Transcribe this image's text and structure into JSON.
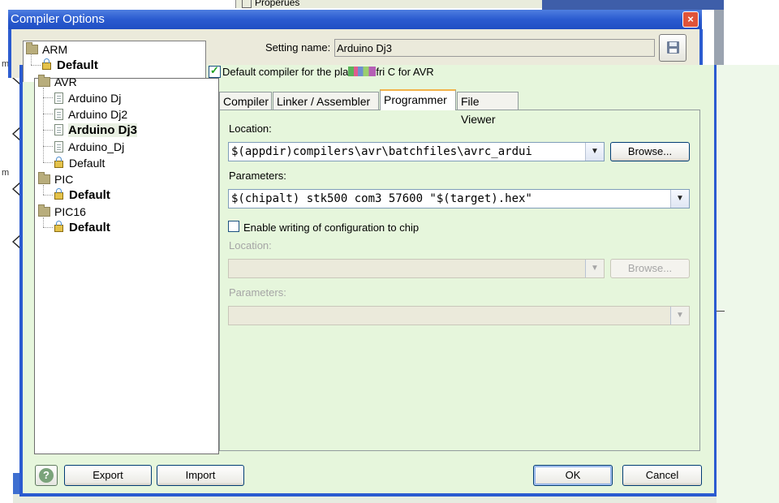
{
  "background": {
    "properties_label": "Properues",
    "left_labels": [
      "m",
      "m"
    ]
  },
  "dialog": {
    "title": "Compiler Options",
    "close_glyph": "×"
  },
  "tree": {
    "groups": [
      {
        "label": "ARM",
        "children": [
          {
            "label": "Default",
            "kind": "lock",
            "bold": true
          }
        ]
      },
      {
        "label": "AVR",
        "children": [
          {
            "label": "Arduino Dj",
            "kind": "doc"
          },
          {
            "label": "Arduino Dj2",
            "kind": "doc"
          },
          {
            "label": "Arduino Dj3",
            "kind": "doc",
            "bold": true,
            "selected": true
          },
          {
            "label": "Arduino_Dj",
            "kind": "doc"
          },
          {
            "label": "Default",
            "kind": "lock"
          }
        ]
      },
      {
        "label": "PIC",
        "children": [
          {
            "label": "Default",
            "kind": "lock",
            "bold": true
          }
        ]
      },
      {
        "label": "PIC16",
        "children": [
          {
            "label": "Default",
            "kind": "lock",
            "bold": true
          }
        ]
      }
    ]
  },
  "setting": {
    "label": "Setting name:",
    "value": "Arduino Dj3"
  },
  "default_compiler": {
    "label_before": "Default compiler for the pla",
    "label_after": "fri C for AVR",
    "checked": true
  },
  "tabs": [
    {
      "label": "Compiler"
    },
    {
      "label": "Linker / Assembler"
    },
    {
      "label": "Programmer",
      "active": true
    },
    {
      "label": "File Viewer"
    }
  ],
  "programmer": {
    "location_label": "Location:",
    "location_value": "$(appdir)compilers\\avr\\batchfiles\\avrc_ardui",
    "browse_label": "Browse...",
    "parameters_label": "Parameters:",
    "parameters_value": "$(chipalt) stk500 com3 57600 \"$(target).hex\"",
    "config_checkbox_label": "Enable writing of configuration to chip",
    "config_checked": false,
    "config_location_label": "Location:",
    "config_browse_label": "Browse...",
    "config_parameters_label": "Parameters:"
  },
  "footer": {
    "help_glyph": "?",
    "export_label": "Export",
    "import_label": "Import",
    "ok_label": "OK",
    "cancel_label": "Cancel"
  },
  "icons": {
    "folder": "folder-icon",
    "document": "document-icon",
    "lock": "lock-icon",
    "save": "floppy-disk-icon",
    "help": "help-icon",
    "dropdown": "chevron-down-icon"
  },
  "colors": {
    "titlebar": "#2a5bd0",
    "dialog_bg": "#e6f6dc",
    "tab_active_accent": "#f2b34a"
  }
}
